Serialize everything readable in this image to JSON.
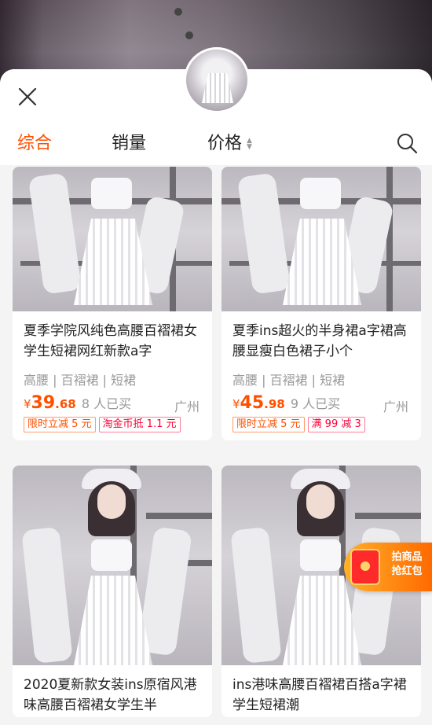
{
  "header": {
    "tabs": [
      {
        "label": "综合",
        "active": true
      },
      {
        "label": "销量",
        "active": false
      },
      {
        "label": "价格",
        "active": false
      }
    ],
    "price_sort_icon": "sort-updown-icon",
    "search_icon": "search-icon",
    "close_icon": "close-icon"
  },
  "products": [
    {
      "title": "夏季学院风纯色高腰百褶裙女学生短裙网红新款a字",
      "tags": "高腰 | 百褶裙 | 短裙",
      "price_yen": "¥",
      "price_int": "39",
      "price_dec": ".68",
      "sold": "8 人已买",
      "location": "广州",
      "badges": [
        {
          "text": "限时立减 5 元",
          "style": "orange"
        },
        {
          "text": "淘金币抵 1.1 元",
          "style": "red"
        }
      ]
    },
    {
      "title": "夏季ins超火的半身裙a字裙高腰显瘦白色裙子小个",
      "tags": "高腰 | 百褶裙 | 短裙",
      "price_yen": "¥",
      "price_int": "45",
      "price_dec": ".98",
      "sold": "9 人已买",
      "location": "广州",
      "badges": [
        {
          "text": "限时立减 5 元",
          "style": "orange"
        },
        {
          "text": "满 99 减 3",
          "style": "red"
        }
      ]
    },
    {
      "title": "2020夏新款女装ins原宿风港味高腰百褶裙女学生半"
    },
    {
      "title": "ins港味高腰百褶裙百搭a字裙学生短裙潮"
    }
  ],
  "redpack": {
    "line1": "拍商品",
    "line2": "抢红包"
  },
  "colors": {
    "accent": "#ff5000",
    "badge_red": "#ff0036"
  }
}
